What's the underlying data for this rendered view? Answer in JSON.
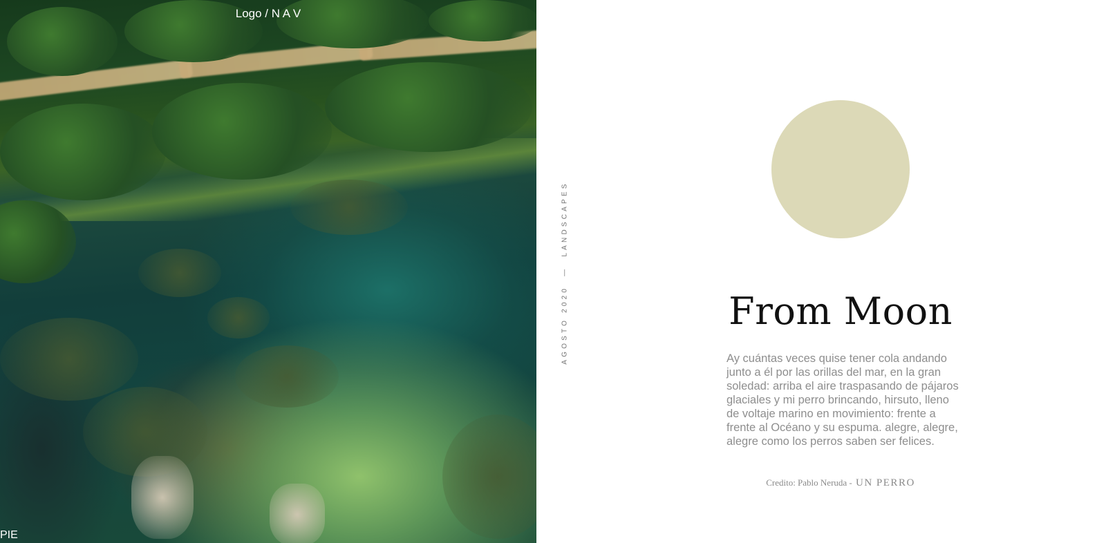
{
  "header": {
    "nav_logo": "Logo / N A V"
  },
  "footer": {
    "label": "PIE"
  },
  "hero_image": {
    "description_icon": "aerial-lake-photo"
  },
  "meta": {
    "date": "AGOSTO 2020",
    "separator": "—",
    "category": "LANDSCAPES"
  },
  "moon": {
    "color": "#dcd9b7"
  },
  "article": {
    "title": "From Moon",
    "body": "Ay cuántas veces quise tener cola andando junto a él por las orillas del mar, en la gran soledad: arriba el aire traspasando de pájaros glaciales y mi perro brincando, hirsuto, lleno de voltaje marino en movimiento: frente a frente al Océano y su espuma. alegre, alegre, alegre como los perros saben ser felices.",
    "credit_prefix": "Credito: Pablo Neruda - ",
    "credit_work": "UN PERRO"
  }
}
